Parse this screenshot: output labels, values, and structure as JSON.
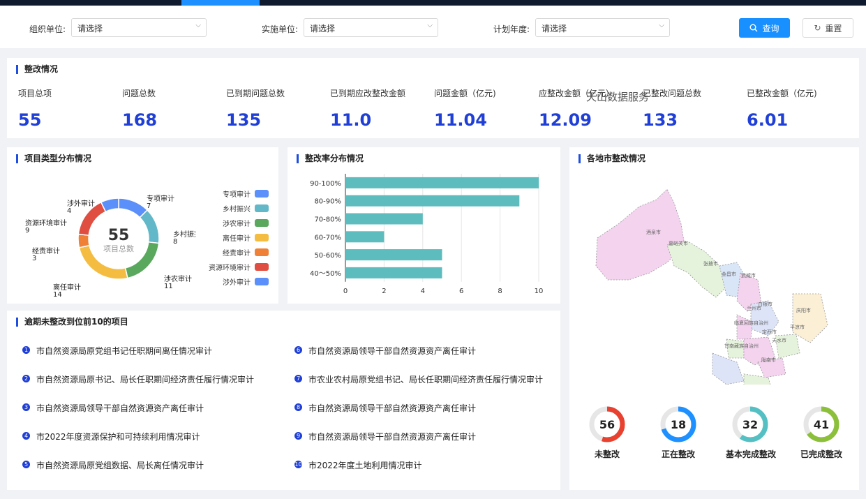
{
  "filters": {
    "org_label": "组织单位:",
    "org_value": "请选择",
    "impl_label": "实施单位:",
    "impl_value": "请选择",
    "year_label": "计划年度:",
    "year_value": "请选择",
    "query_label": "查询",
    "reset_label": "重置"
  },
  "summary": {
    "title": "整改情况",
    "watermark": "天山数据服务",
    "stats": [
      {
        "label": "项目总项",
        "value": "55"
      },
      {
        "label": "问题总数",
        "value": "168"
      },
      {
        "label": "已到期问题总数",
        "value": "135"
      },
      {
        "label": "已到期应改整改金额",
        "value": "11.0"
      },
      {
        "label": "问题金额（亿元)",
        "value": "11.04"
      },
      {
        "label": "应整改金额（亿元）",
        "value": "12.09"
      },
      {
        "label": "已整改问题总数",
        "value": "133"
      },
      {
        "label": "已整改金额（亿元)",
        "value": "6.01"
      }
    ]
  },
  "donut": {
    "title": "项目类型分布情况",
    "center_value": "55",
    "center_label": "项目总数",
    "slices": [
      {
        "name": "专项审计",
        "value": 7,
        "color": "#5b8ff9"
      },
      {
        "name": "乡村振兴",
        "value": 8,
        "color": "#62b8c8"
      },
      {
        "name": "涉农审计",
        "value": 11,
        "color": "#5aa85e"
      },
      {
        "name": "离任审计",
        "value": 14,
        "color": "#f4bd42"
      },
      {
        "name": "经责审计",
        "value": 3,
        "color": "#f08035"
      },
      {
        "name": "资源环境审计",
        "value": 9,
        "color": "#df4e40"
      },
      {
        "name": "涉外审计",
        "value": 4,
        "color": "#5b8ff9"
      }
    ],
    "legend": [
      "专项审计",
      "乡村振兴",
      "涉农审计",
      "离任审计",
      "经责审计",
      "资源环境审计",
      "涉外审计"
    ]
  },
  "bar": {
    "title": "整改率分布情况",
    "chart_data": {
      "type": "bar",
      "orientation": "horizontal",
      "categories": [
        "90-100%",
        "80-90%",
        "70-80%",
        "60-70%",
        "50-60%",
        "40～50%"
      ],
      "values": [
        10,
        9,
        4,
        2,
        5,
        5
      ],
      "xlim": [
        0,
        10
      ],
      "xticks": [
        "0",
        "2",
        "4",
        "6",
        "8",
        "10"
      ],
      "color": "#5dbcbd"
    }
  },
  "map": {
    "title": "各地市整改情况",
    "cities": [
      "酒泉市",
      "嘉峪关市",
      "张掖市",
      "金昌市",
      "武威市",
      "白银市",
      "兰州市",
      "庆阳市",
      "临夏回族自治州",
      "定西市",
      "平凉市",
      "甘南藏族自治州",
      "天水市",
      "陇南市"
    ]
  },
  "rings": [
    {
      "value": "56",
      "label": "未整改",
      "color": "#e8412f",
      "fraction": 0.55
    },
    {
      "value": "18",
      "label": "正在整改",
      "color": "#1e90ff",
      "fraction": 0.7
    },
    {
      "value": "32",
      "label": "基本完成整改",
      "color": "#55c0c4",
      "fraction": 0.6
    },
    {
      "value": "41",
      "label": "已完成整改",
      "color": "#8cbf3a",
      "fraction": 0.65
    }
  ],
  "overdue": {
    "title": "逾期未整改到位前10的项目",
    "items": [
      {
        "num": "1",
        "text": "市自然资源局原党组书记任职期间离任情况审计"
      },
      {
        "num": "2",
        "text": "市自然资源局原书记、局长任职期间经济责任履行情况审计"
      },
      {
        "num": "3",
        "text": "市自然资源局领导干部自然资源资产离任审计"
      },
      {
        "num": "4",
        "text": "市2022年度资源保护和可持续利用情况审计"
      },
      {
        "num": "5",
        "text": "市自然资源局原党组数据、局长离任情况审计"
      },
      {
        "num": "6",
        "text": "市自然资源局领导干部自然资源资产离任审计"
      },
      {
        "num": "7",
        "text": "市农业农村局原党组书记、局长任职期间经济责任履行情况审计"
      },
      {
        "num": "8",
        "text": "市自然资源局领导干部自然资源资产离任审计"
      },
      {
        "num": "9",
        "text": "市自然资源局领导干部自然资源资产离任审计"
      },
      {
        "num": "10",
        "text": "市2022年度土地利用情况审计"
      }
    ]
  }
}
